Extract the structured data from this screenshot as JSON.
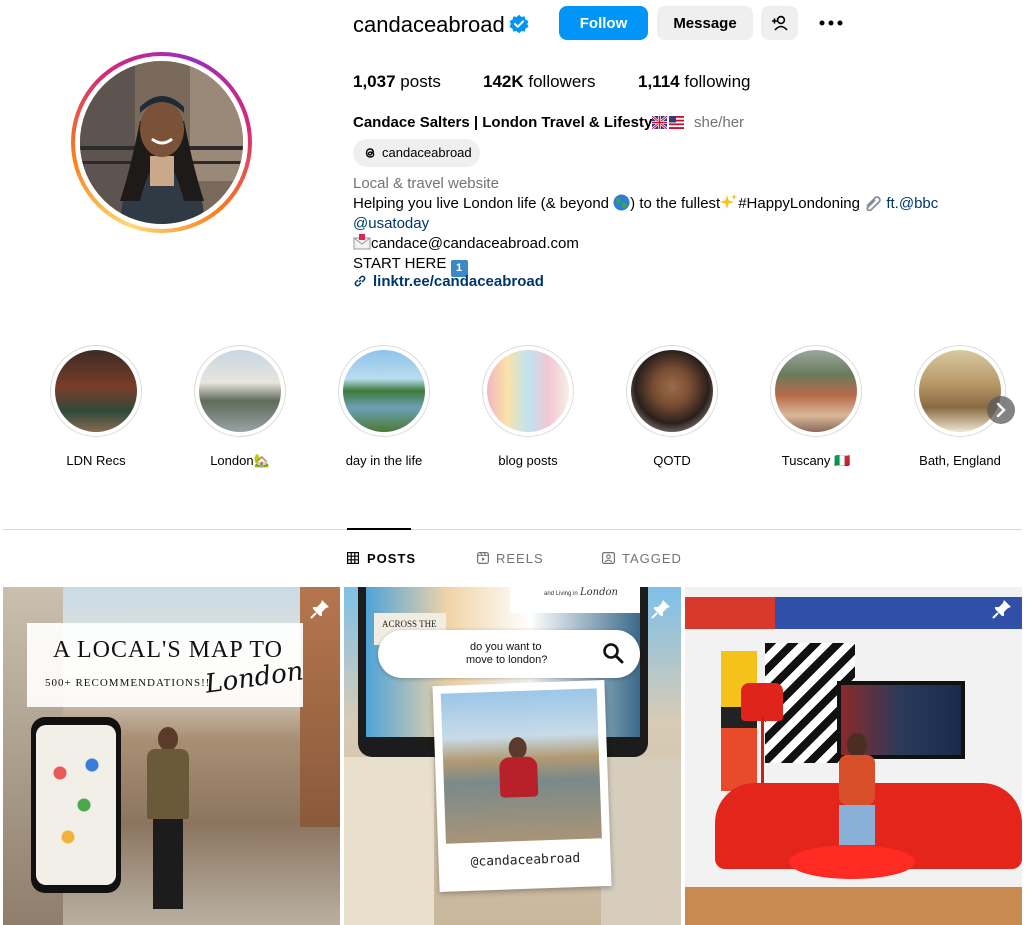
{
  "profile": {
    "username": "candaceabroad",
    "verified_icon": "verified-badge-icon",
    "follow_label": "Follow",
    "message_label": "Message",
    "stats": {
      "posts_value": "1,037",
      "posts_label": "posts",
      "followers_value": "142K",
      "followers_label": "followers",
      "following_value": "1,114",
      "following_label": "following"
    },
    "full_name": "Candace Salters | London Travel & Lifestyle",
    "pronouns": "she/her",
    "threads_handle": "candaceabroad",
    "category": "Local & travel website",
    "bio": {
      "line1_a": "Helping you live London life (& beyond ",
      "line1_b": ") to the fullest",
      "line1_c": "#HappyLondoning ",
      "line1_mention": "ft.@bbc",
      "line2": "@usatoday",
      "line3": "candace@candaceabroad.com",
      "line4": "START HERE",
      "line4_emoji": "1"
    },
    "link": "linktr.ee/candaceabroad"
  },
  "highlights": [
    {
      "label": "LDN Recs"
    },
    {
      "label": "London🏡"
    },
    {
      "label": "day in the life"
    },
    {
      "label": "blog posts"
    },
    {
      "label": "QOTD"
    },
    {
      "label": "Tuscany 🇮🇹"
    },
    {
      "label": "Bath, England"
    }
  ],
  "tabs": {
    "posts": "POSTS",
    "reels": "REELS",
    "tagged": "TAGGED"
  },
  "posts": [
    {
      "title": "A LOCAL'S MAP TO",
      "subtitle": "500+ RECOMMENDATIONS!!",
      "script": "London"
    },
    {
      "search_text_1": "do you want to",
      "search_text_2": "move to london?",
      "handle": "@candaceabroad",
      "card_top": "and Living in",
      "card_script": "London",
      "sign": "ACROSS THE"
    },
    {}
  ],
  "colors": {
    "accent_blue": "#0095f6",
    "link_blue": "#00376b",
    "secondary_gray": "#737373",
    "button_gray": "#efefef"
  }
}
